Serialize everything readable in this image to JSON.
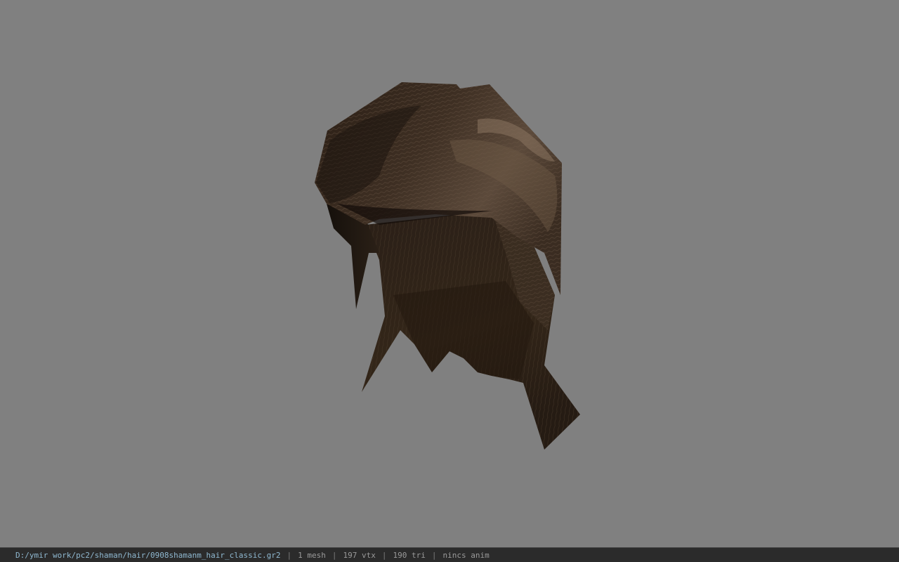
{
  "viewer": {
    "background_color": "#808080",
    "model_icon": "hair-mesh-model",
    "hair_colors": {
      "dark": "#1c140e",
      "mid": "#3a2c21",
      "light": "#6e5a48",
      "highlight": "#9a8670"
    }
  },
  "statusbar": {
    "file_path": "D:/ymir work/pc2/shaman/hair/0908shamanm_hair_classic.gr2",
    "separator": "|",
    "mesh_count": "1 mesh",
    "vertex_count": "197 vtx",
    "triangle_count": "190 tri",
    "animation": "nincs anim"
  }
}
